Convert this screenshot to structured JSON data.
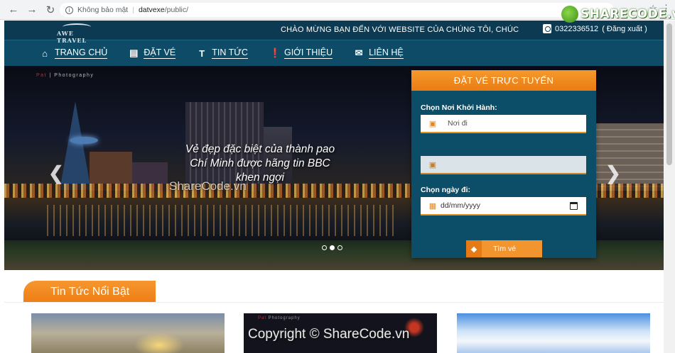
{
  "browser": {
    "security_label": "Không bảo mật",
    "url_host": "datvexe",
    "url_path": "/public/"
  },
  "watermark": {
    "logo_text": "SHARECODE.vn",
    "hero_text": "ShareCode.vn",
    "copyright": "Copyright © ShareCode.vn"
  },
  "header": {
    "logo_text": "AWE TRAVEL",
    "welcome": "CHÀO MỪNG BẠN ĐẾN VỚI WEBSITE CỦA CHÚNG TÔI, CHÚC",
    "phone": "0322336512",
    "logout": "( Đăng xuất )"
  },
  "nav": {
    "items": [
      {
        "label": "TRANG CHỦ",
        "icon": "home-icon"
      },
      {
        "label": "ĐẶT VÉ",
        "icon": "list-icon"
      },
      {
        "label": "TIN TỨC",
        "icon": "text-icon"
      },
      {
        "label": "GIỚI THIỆU",
        "icon": "info-icon"
      },
      {
        "label": "LIÊN HỆ",
        "icon": "mail-icon"
      }
    ]
  },
  "hero": {
    "photo_tag_brand": "Pat",
    "photo_tag_rest": " | Photography",
    "caption_line1": "Vẻ đẹp đặc biệt của thành pao",
    "caption_line2": "Chí Minh được hãng tin BBC",
    "caption_line3": "khen ngợi"
  },
  "booking": {
    "title": "ĐẶT VÉ TRỰC TUYẾN",
    "from_label": "Chọn Nơi Khởi Hành:",
    "from_placeholder": "Nơi đi",
    "date_label": "Chọn ngày đi:",
    "date_placeholder": "dd/mm/yyyy",
    "search_label": "Tìm vé"
  },
  "news": {
    "title": "Tin Tức Nổi Bật",
    "card2_tag_brand": "Pat",
    "card2_tag_rest": " Photography"
  },
  "colors": {
    "primary": "#0e4b66",
    "accent": "#f2952f"
  }
}
